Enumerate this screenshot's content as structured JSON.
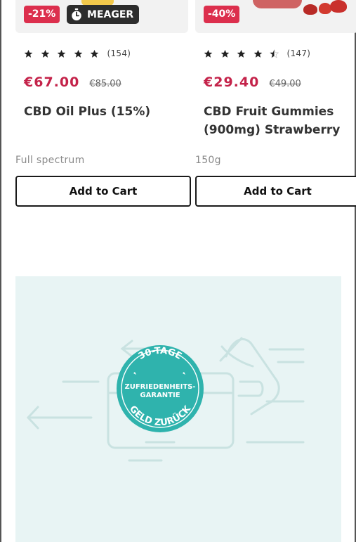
{
  "products": [
    {
      "discount": "-21%",
      "tag": "MEAGER",
      "rating": 5,
      "review_count": "(154)",
      "price": "€67.00",
      "old_price": "€85.00",
      "title": "CBD Oil Plus (15%)",
      "subtitle": "Full spectrum",
      "cart_label": "Add to Cart"
    },
    {
      "discount": "-40%",
      "rating": 4.5,
      "review_count": "(147)",
      "price": "€29.40",
      "old_price": "€49.00",
      "title": "CBD Fruit Gummies (900mg) Strawberry",
      "subtitle": "150g",
      "cart_label": "Add to Cart"
    }
  ],
  "guarantee": {
    "top_text": "30-TAGE",
    "middle_line1": "ZUFRIEDENHEITS-",
    "middle_line2": "GARANTIE",
    "bottom_text": "GELD ZURÜCK"
  },
  "colors": {
    "accent_red": "#dc2f4d",
    "price_red": "#c4234a",
    "seal_teal": "#2fb3ad",
    "promo_bg": "#e8f4f4"
  },
  "icons": [
    "timer-icon",
    "star-icon",
    "half-star-icon",
    "leaf-icon"
  ]
}
